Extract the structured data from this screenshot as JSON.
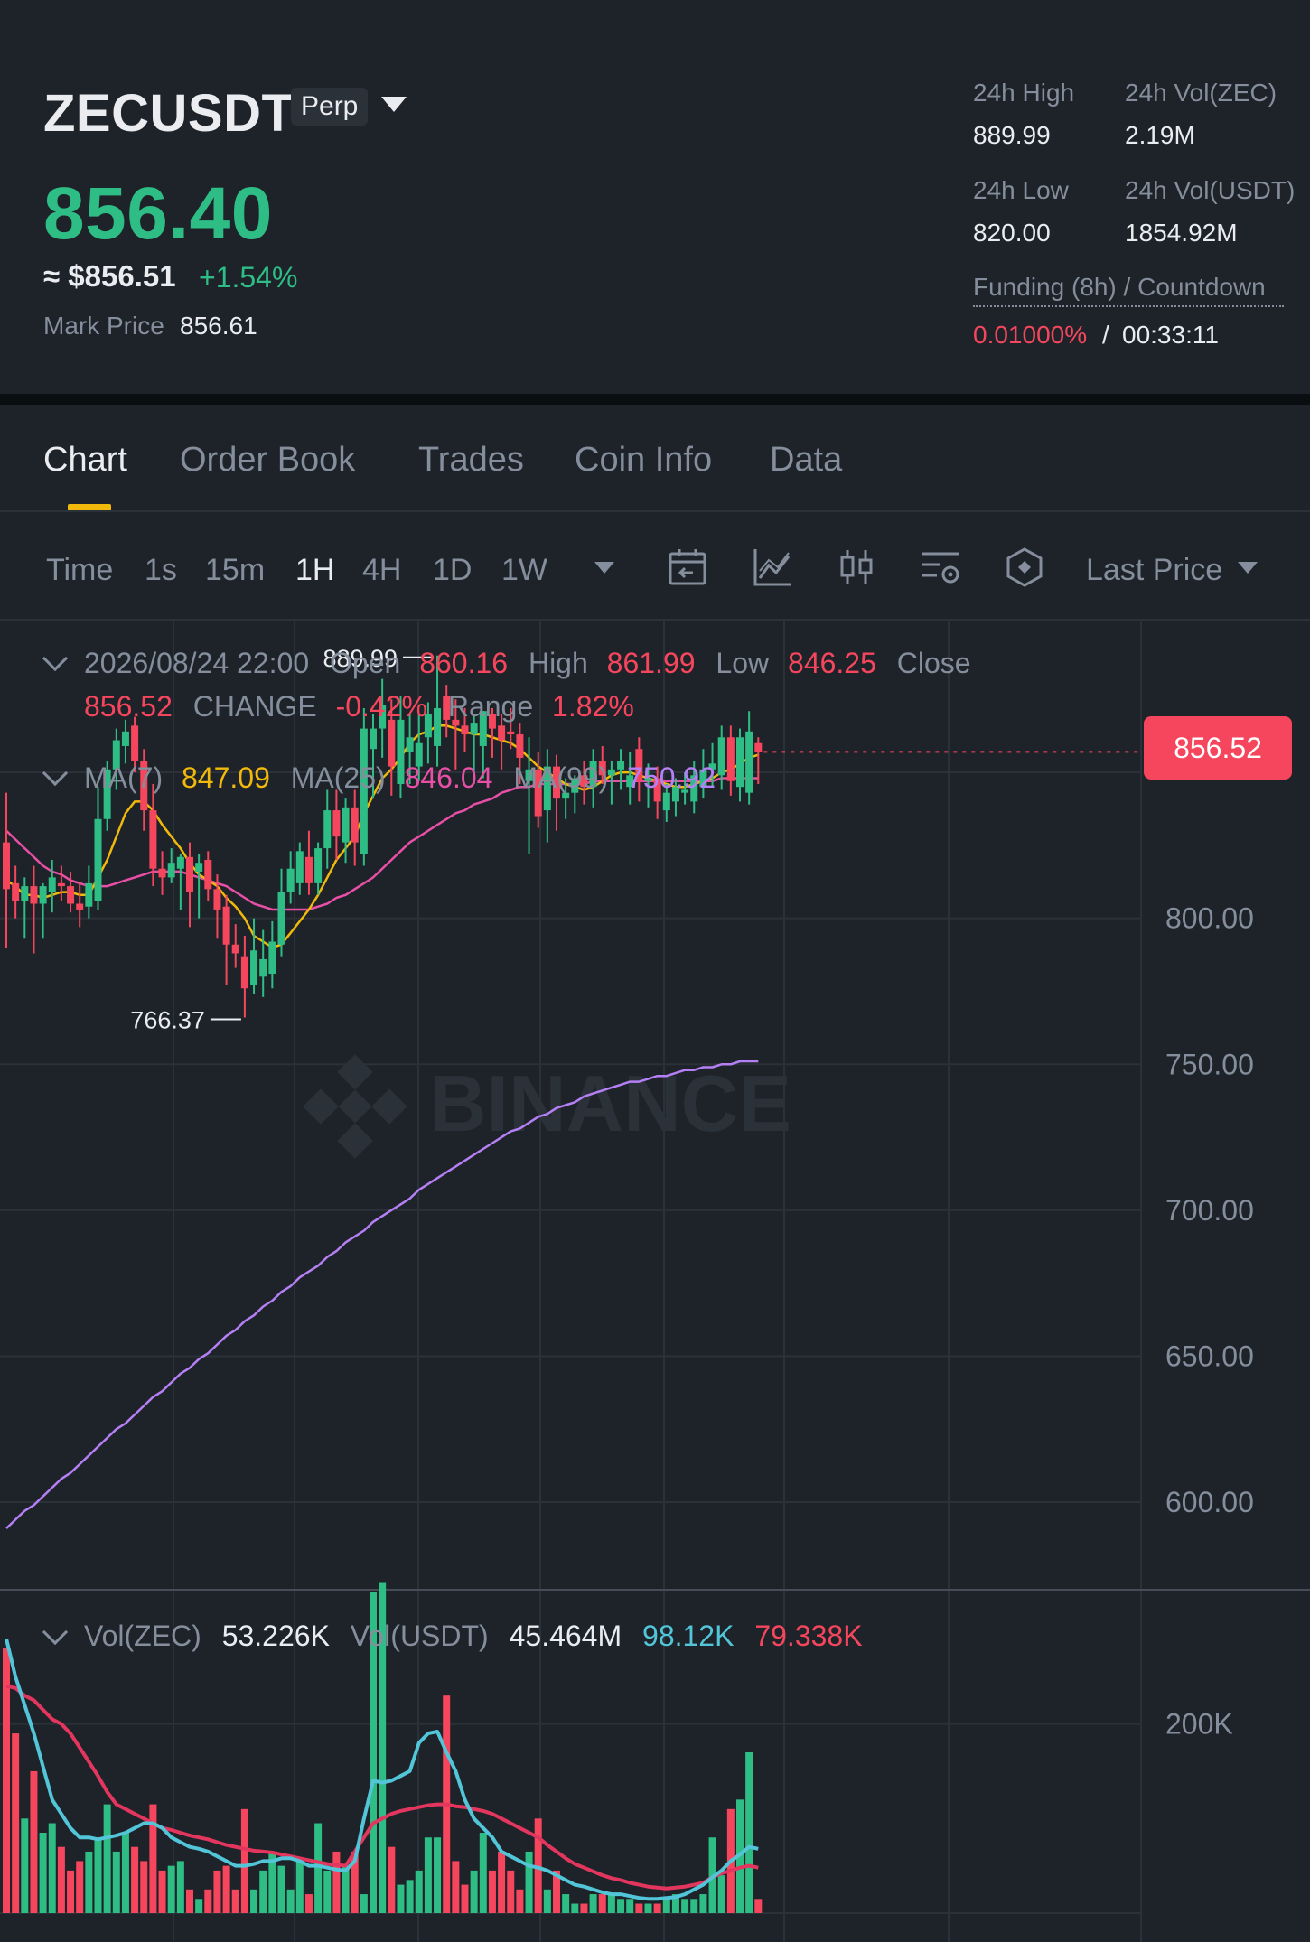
{
  "header": {
    "symbol": "ZECUSDT",
    "contract_type": "Perp",
    "last_price": "856.40",
    "usd_approx": "≈ $856.51",
    "change_pct": "+1.54%",
    "mark_price_label": "Mark Price",
    "mark_price": "856.61",
    "stats": {
      "high_label": "24h High",
      "high": "889.99",
      "vol_base_label": "24h Vol(ZEC)",
      "vol_base": "2.19M",
      "low_label": "24h Low",
      "low": "820.00",
      "vol_quote_label": "24h Vol(USDT)",
      "vol_quote": "1854.92M"
    },
    "funding_label": "Funding (8h) / Countdown",
    "funding_rate": "0.01000%",
    "funding_sep": "/",
    "countdown": "00:33:11"
  },
  "tabs": [
    "Chart",
    "Order Book",
    "Trades",
    "Coin Info",
    "Data"
  ],
  "toolbar": {
    "timeframes": [
      "Time",
      "1s",
      "15m",
      "1H",
      "4H",
      "1D",
      "1W"
    ],
    "active_timeframe": "1H",
    "icons": [
      "calendar-icon",
      "indicator-icon",
      "candle-style-icon",
      "chart-settings-icon",
      "depth-icon"
    ],
    "price_type": "Last Price"
  },
  "ohlc_legend": {
    "datetime": "2026/08/24 22:00",
    "open_label": "Open",
    "open": "860.16",
    "high_label": "High",
    "high": "861.99",
    "low_label": "Low",
    "low": "846.25",
    "close_label": "Close",
    "close": "856.52",
    "change_label": "CHANGE",
    "change": "-0.42%",
    "range_label": "Range",
    "range": "1.82%"
  },
  "ma_legend": {
    "ma7_label": "MA(7)",
    "ma7": "847.09",
    "ma25_label": "MA(25)",
    "ma25": "846.04",
    "ma99_label": "MA(99)",
    "ma99": "750.92"
  },
  "vol_legend": {
    "base_label": "Vol(ZEC)",
    "base": "53.226K",
    "quote_label": "Vol(USDT)",
    "quote": "45.464M",
    "ma5": "98.12K",
    "ma10": "79.338K"
  },
  "watermark": "BINANCE",
  "colors": {
    "up": "#2ebd85",
    "down": "#f6465d",
    "ma7": "#f0b90b",
    "ma25": "#e84fa6",
    "ma99": "#b57ff5",
    "vol_ma5": "#52c5d9",
    "vol_ma10": "#e3365e",
    "accent": "#f0b90b",
    "background": "#1e2329"
  },
  "chart_data": {
    "type": "candlestick",
    "price_axis_ticks": [
      "800.00",
      "750.00",
      "700.00",
      "650.00",
      "600.00"
    ],
    "price_ylim": [
      570,
      902
    ],
    "current_price_tag": "856.52",
    "max_marker": "889.99",
    "min_marker": "766.37",
    "volume_axis_ticks": [
      "200K"
    ],
    "volume_ylim": [
      0,
      340
    ],
    "candles": [
      {
        "o": 826,
        "h": 843,
        "l": 790,
        "c": 810
      },
      {
        "o": 812,
        "h": 818,
        "l": 800,
        "c": 806
      },
      {
        "o": 806,
        "h": 814,
        "l": 793,
        "c": 811
      },
      {
        "o": 811,
        "h": 818,
        "l": 788,
        "c": 805
      },
      {
        "o": 805,
        "h": 812,
        "l": 793,
        "c": 811
      },
      {
        "o": 809,
        "h": 820,
        "l": 802,
        "c": 814
      },
      {
        "o": 812,
        "h": 818,
        "l": 806,
        "c": 811
      },
      {
        "o": 811,
        "h": 816,
        "l": 802,
        "c": 805
      },
      {
        "o": 805,
        "h": 812,
        "l": 797,
        "c": 803
      },
      {
        "o": 804,
        "h": 818,
        "l": 800,
        "c": 812
      },
      {
        "o": 806,
        "h": 845,
        "l": 803,
        "c": 834
      },
      {
        "o": 834,
        "h": 854,
        "l": 830,
        "c": 851
      },
      {
        "o": 851,
        "h": 865,
        "l": 844,
        "c": 861
      },
      {
        "o": 859,
        "h": 868,
        "l": 853,
        "c": 864
      },
      {
        "o": 866,
        "h": 869,
        "l": 850,
        "c": 854
      },
      {
        "o": 854,
        "h": 858,
        "l": 830,
        "c": 837
      },
      {
        "o": 837,
        "h": 846,
        "l": 811,
        "c": 817
      },
      {
        "o": 817,
        "h": 823,
        "l": 808,
        "c": 814
      },
      {
        "o": 814,
        "h": 824,
        "l": 812,
        "c": 819
      },
      {
        "o": 817,
        "h": 822,
        "l": 803,
        "c": 821
      },
      {
        "o": 821,
        "h": 826,
        "l": 797,
        "c": 809
      },
      {
        "o": 816,
        "h": 822,
        "l": 800,
        "c": 819
      },
      {
        "o": 820,
        "h": 823,
        "l": 806,
        "c": 810
      },
      {
        "o": 810,
        "h": 815,
        "l": 793,
        "c": 803
      },
      {
        "o": 804,
        "h": 808,
        "l": 777,
        "c": 791
      },
      {
        "o": 791,
        "h": 798,
        "l": 783,
        "c": 788
      },
      {
        "o": 787,
        "h": 794,
        "l": 766,
        "c": 776
      },
      {
        "o": 777,
        "h": 800,
        "l": 774,
        "c": 789
      },
      {
        "o": 780,
        "h": 796,
        "l": 773,
        "c": 786
      },
      {
        "o": 781,
        "h": 799,
        "l": 776,
        "c": 792
      },
      {
        "o": 791,
        "h": 817,
        "l": 787,
        "c": 809
      },
      {
        "o": 809,
        "h": 823,
        "l": 805,
        "c": 817
      },
      {
        "o": 812,
        "h": 826,
        "l": 808,
        "c": 823
      },
      {
        "o": 821,
        "h": 830,
        "l": 808,
        "c": 812
      },
      {
        "o": 812,
        "h": 826,
        "l": 808,
        "c": 824
      },
      {
        "o": 824,
        "h": 844,
        "l": 817,
        "c": 837
      },
      {
        "o": 837,
        "h": 844,
        "l": 820,
        "c": 828
      },
      {
        "o": 826,
        "h": 841,
        "l": 819,
        "c": 838
      },
      {
        "o": 838,
        "h": 844,
        "l": 818,
        "c": 826
      },
      {
        "o": 822,
        "h": 872,
        "l": 818,
        "c": 865
      },
      {
        "o": 858,
        "h": 870,
        "l": 841,
        "c": 865
      },
      {
        "o": 865,
        "h": 882,
        "l": 855,
        "c": 873
      },
      {
        "o": 868,
        "h": 875,
        "l": 842,
        "c": 852
      },
      {
        "o": 846,
        "h": 876,
        "l": 841,
        "c": 868
      },
      {
        "o": 857,
        "h": 870,
        "l": 846,
        "c": 862
      },
      {
        "o": 852,
        "h": 870,
        "l": 847,
        "c": 860
      },
      {
        "o": 862,
        "h": 874,
        "l": 853,
        "c": 870
      },
      {
        "o": 859,
        "h": 890,
        "l": 852,
        "c": 872
      },
      {
        "o": 876,
        "h": 880,
        "l": 862,
        "c": 868
      },
      {
        "o": 868,
        "h": 875,
        "l": 851,
        "c": 866
      },
      {
        "o": 866,
        "h": 872,
        "l": 857,
        "c": 863
      },
      {
        "o": 863,
        "h": 870,
        "l": 846,
        "c": 867
      },
      {
        "o": 859,
        "h": 871,
        "l": 848,
        "c": 871
      },
      {
        "o": 870,
        "h": 872,
        "l": 855,
        "c": 865
      },
      {
        "o": 866,
        "h": 870,
        "l": 851,
        "c": 861
      },
      {
        "o": 864,
        "h": 872,
        "l": 858,
        "c": 863
      },
      {
        "o": 863,
        "h": 867,
        "l": 846,
        "c": 855
      },
      {
        "o": 847,
        "h": 862,
        "l": 822,
        "c": 851
      },
      {
        "o": 851,
        "h": 857,
        "l": 831,
        "c": 835
      },
      {
        "o": 837,
        "h": 858,
        "l": 826,
        "c": 852
      },
      {
        "o": 852,
        "h": 856,
        "l": 830,
        "c": 841
      },
      {
        "o": 841,
        "h": 848,
        "l": 834,
        "c": 843
      },
      {
        "o": 843,
        "h": 849,
        "l": 836,
        "c": 848
      },
      {
        "o": 849,
        "h": 854,
        "l": 839,
        "c": 845
      },
      {
        "o": 845,
        "h": 858,
        "l": 838,
        "c": 854
      },
      {
        "o": 854,
        "h": 859,
        "l": 846,
        "c": 849
      },
      {
        "o": 849,
        "h": 854,
        "l": 839,
        "c": 851
      },
      {
        "o": 851,
        "h": 858,
        "l": 844,
        "c": 854
      },
      {
        "o": 845,
        "h": 857,
        "l": 839,
        "c": 849
      },
      {
        "o": 858,
        "h": 862,
        "l": 840,
        "c": 847
      },
      {
        "o": 847,
        "h": 853,
        "l": 838,
        "c": 848
      },
      {
        "o": 848,
        "h": 852,
        "l": 834,
        "c": 840
      },
      {
        "o": 837,
        "h": 846,
        "l": 833,
        "c": 843
      },
      {
        "o": 840,
        "h": 848,
        "l": 835,
        "c": 845
      },
      {
        "o": 843,
        "h": 850,
        "l": 839,
        "c": 844
      },
      {
        "o": 840,
        "h": 854,
        "l": 836,
        "c": 849
      },
      {
        "o": 845,
        "h": 858,
        "l": 841,
        "c": 851
      },
      {
        "o": 851,
        "h": 860,
        "l": 845,
        "c": 853
      },
      {
        "o": 849,
        "h": 866,
        "l": 844,
        "c": 862
      },
      {
        "o": 862,
        "h": 866,
        "l": 842,
        "c": 847
      },
      {
        "o": 845,
        "h": 865,
        "l": 840,
        "c": 862
      },
      {
        "o": 843,
        "h": 871,
        "l": 839,
        "c": 864
      },
      {
        "o": 860,
        "h": 862,
        "l": 846,
        "c": 857
      }
    ],
    "ma7": [
      813,
      811,
      808,
      808,
      807,
      808,
      809,
      809,
      808,
      808,
      814,
      820,
      828,
      836,
      840,
      840,
      837,
      832,
      828,
      824,
      819,
      815,
      813,
      811,
      807,
      804,
      800,
      794,
      792,
      790,
      791,
      795,
      799,
      803,
      808,
      814,
      820,
      824,
      828,
      836,
      842,
      848,
      851,
      855,
      860,
      863,
      864,
      866,
      866,
      865,
      864,
      863,
      863,
      862,
      861,
      860,
      858,
      855,
      852,
      850,
      848,
      846,
      845,
      844,
      845,
      847,
      849,
      850,
      850,
      849,
      848,
      847,
      846,
      845,
      845,
      846,
      847,
      848,
      850,
      851,
      853,
      855,
      856
    ],
    "ma25": [
      830,
      827,
      824,
      821,
      818,
      816,
      815,
      813,
      812,
      811,
      811,
      811,
      812,
      813,
      814,
      815,
      816,
      816,
      816,
      816,
      815,
      814,
      813,
      812,
      811,
      809,
      807,
      805,
      804,
      803,
      803,
      803,
      803,
      803,
      804,
      805,
      807,
      808,
      810,
      812,
      814,
      817,
      820,
      823,
      826,
      828,
      830,
      832,
      834,
      836,
      837,
      839,
      840,
      841,
      843,
      844,
      845,
      845,
      846,
      846,
      846,
      846,
      846,
      846,
      847,
      847,
      847,
      847,
      847,
      847,
      847,
      847,
      847,
      847,
      847,
      847,
      847,
      847,
      848,
      848,
      848,
      848,
      848
    ],
    "ma99": [
      591,
      594,
      597,
      599,
      602,
      605,
      608,
      610,
      613,
      616,
      619,
      622,
      625,
      627,
      630,
      633,
      636,
      638,
      641,
      644,
      646,
      649,
      651,
      654,
      657,
      659,
      662,
      664,
      667,
      669,
      672,
      674,
      677,
      679,
      681,
      684,
      686,
      689,
      691,
      693,
      696,
      698,
      700,
      702,
      704,
      707,
      709,
      711,
      713,
      715,
      717,
      719,
      721,
      723,
      725,
      727,
      728,
      730,
      732,
      733,
      735,
      736,
      737,
      739,
      740,
      741,
      742,
      743,
      744,
      744,
      745,
      746,
      746,
      747,
      748,
      748,
      749,
      749,
      750,
      750,
      751,
      751,
      751
    ],
    "volumes": [
      280,
      190,
      100,
      150,
      85,
      95,
      70,
      45,
      55,
      65,
      80,
      115,
      65,
      85,
      70,
      55,
      115,
      45,
      50,
      55,
      25,
      15,
      25,
      45,
      50,
      25,
      110,
      25,
      45,
      65,
      50,
      25,
      55,
      20,
      95,
      45,
      65,
      50,
      65,
      20,
      340,
      350,
      70,
      30,
      35,
      45,
      80,
      80,
      230,
      55,
      30,
      45,
      85,
      45,
      65,
      45,
      25,
      65,
      100,
      25,
      45,
      20,
      10,
      10,
      20,
      20,
      20,
      15,
      15,
      10,
      10,
      10,
      15,
      20,
      15,
      15,
      20,
      80,
      40,
      110,
      120,
      170,
      15
    ],
    "vol_ma5": [
      290,
      250,
      220,
      190,
      155,
      120,
      105,
      90,
      80,
      80,
      78,
      80,
      82,
      85,
      90,
      95,
      95,
      90,
      80,
      75,
      70,
      68,
      65,
      60,
      55,
      50,
      50,
      52,
      55,
      55,
      58,
      58,
      55,
      50,
      50,
      48,
      46,
      45,
      55,
      100,
      140,
      138,
      140,
      145,
      150,
      180,
      190,
      192,
      170,
      150,
      120,
      100,
      90,
      80,
      65,
      60,
      55,
      50,
      48,
      45,
      40,
      35,
      30,
      28,
      25,
      22,
      20,
      20,
      18,
      16,
      15,
      15,
      16,
      17,
      20,
      25,
      30,
      38,
      45,
      55,
      62,
      70,
      68
    ],
    "vol_ma10": [
      240,
      238,
      230,
      225,
      215,
      205,
      200,
      190,
      175,
      160,
      145,
      128,
      115,
      110,
      105,
      100,
      95,
      90,
      88,
      85,
      82,
      80,
      78,
      75,
      72,
      70,
      68,
      66,
      65,
      64,
      62,
      60,
      58,
      56,
      54,
      52,
      51,
      50,
      65,
      80,
      95,
      100,
      105,
      108,
      110,
      112,
      114,
      115,
      115,
      113,
      112,
      110,
      108,
      105,
      100,
      95,
      90,
      85,
      80,
      72,
      65,
      58,
      52,
      48,
      44,
      40,
      37,
      35,
      32,
      30,
      28,
      27,
      26,
      27,
      28,
      30,
      32,
      38,
      42,
      45,
      48,
      50,
      48
    ]
  }
}
